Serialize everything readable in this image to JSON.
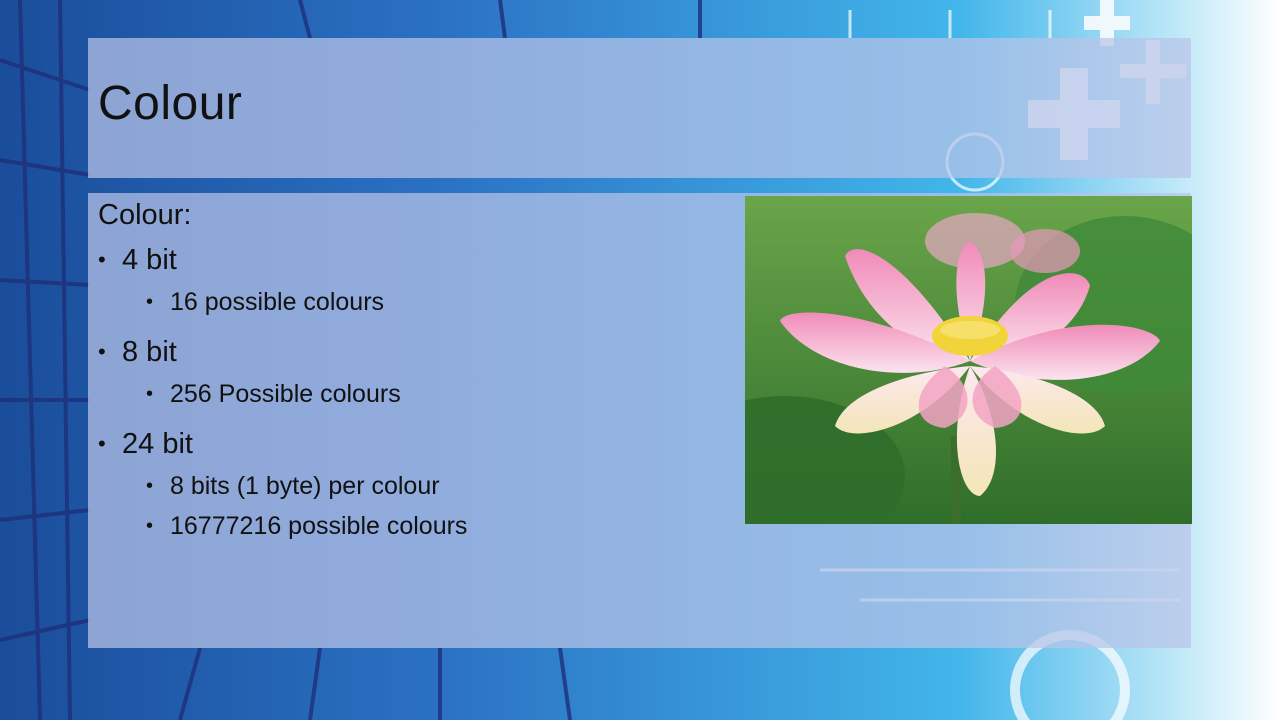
{
  "slide": {
    "title": "Colour",
    "lead": "Colour:",
    "items": [
      {
        "label": "4 bit",
        "subitems": [
          "16 possible colours"
        ]
      },
      {
        "label": "8 bit",
        "subitems": [
          "256 Possible colours"
        ]
      },
      {
        "label": "24 bit",
        "subitems": [
          "8 bits (1 byte) per colour",
          "16777216 possible colours"
        ]
      }
    ],
    "image": {
      "icon": "lotus-flower-photo"
    }
  },
  "colors": {
    "background_blue": "#1e8fd6",
    "panel": "#b9c3e8",
    "lotus_pink": "#f3a3c4",
    "leaf_green": "#4f8f3a"
  }
}
